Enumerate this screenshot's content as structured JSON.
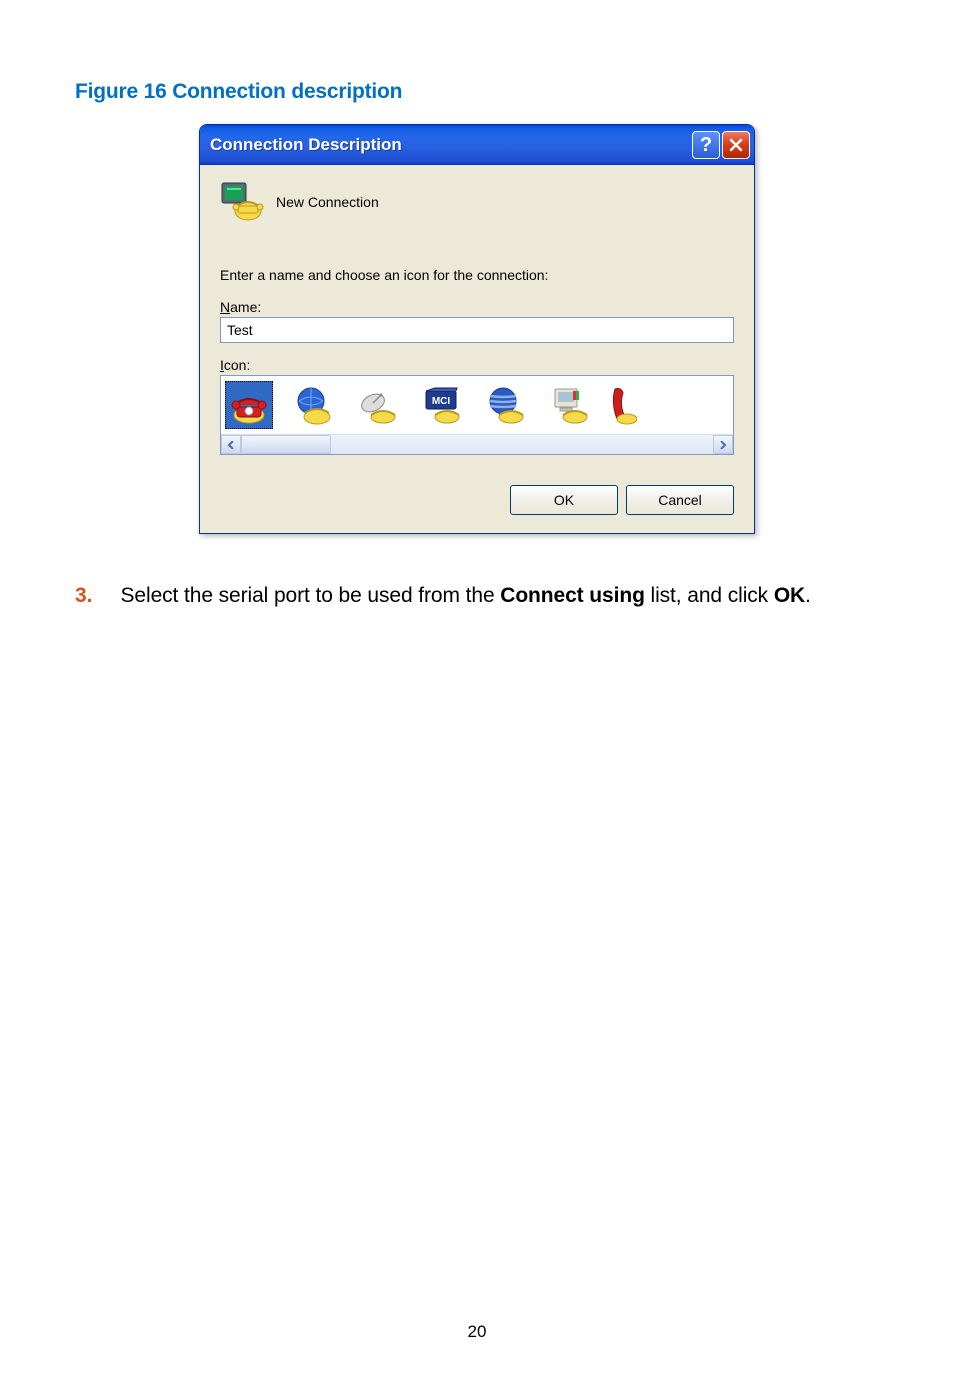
{
  "figure_caption": "Figure 16 Connection description",
  "dialog": {
    "title": "Connection Description",
    "new_connection_label": "New Connection",
    "prompt": "Enter a name and choose an icon for the connection:",
    "name_label_pre": "N",
    "name_label_rest": "ame:",
    "name_value": "Test",
    "icon_label_pre": "I",
    "icon_label_rest": "con:",
    "ok_label": "OK",
    "cancel_label": "Cancel",
    "icons": [
      "red-phone-icon",
      "globe-phone-icon",
      "satellite-dish-icon",
      "mci-icon",
      "att-globe-icon",
      "computer-icon",
      "phone-handset-icon"
    ]
  },
  "step": {
    "number": "3.",
    "text_pre": "Select the serial port to be used from the ",
    "text_bold1": "Connect using",
    "text_mid": " list, and click ",
    "text_bold2": "OK",
    "text_end": "."
  },
  "page_number": "20"
}
